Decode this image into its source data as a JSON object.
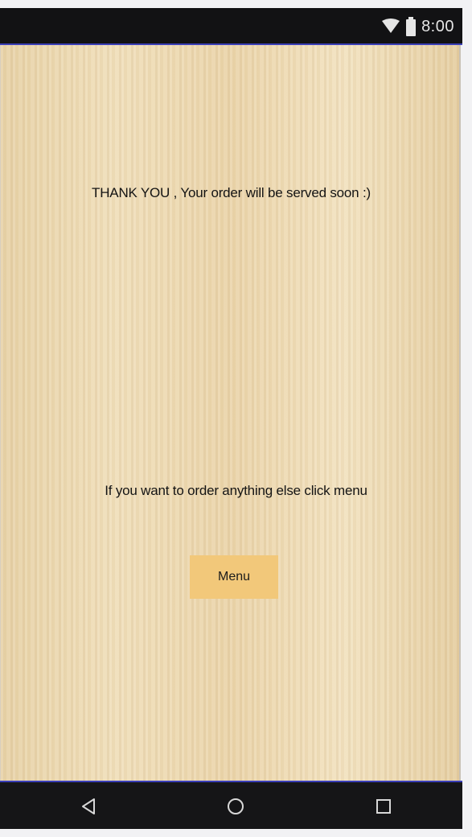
{
  "status_bar": {
    "time": "8:00",
    "icons": [
      "wifi-icon",
      "battery-icon"
    ]
  },
  "content": {
    "thank_you_text": "THANK YOU , Your order will be served soon :)",
    "hint_text": "If you want to order anything else click menu",
    "menu_button_label": "Menu"
  },
  "nav_bar": {
    "buttons": [
      "back-icon",
      "home-icon",
      "recents-icon"
    ]
  },
  "colors": {
    "status_bar": "#121214",
    "accent_line": "#3b3fb8",
    "menu_button": "#f2c87a",
    "wood_background": "#ecd8b0"
  }
}
